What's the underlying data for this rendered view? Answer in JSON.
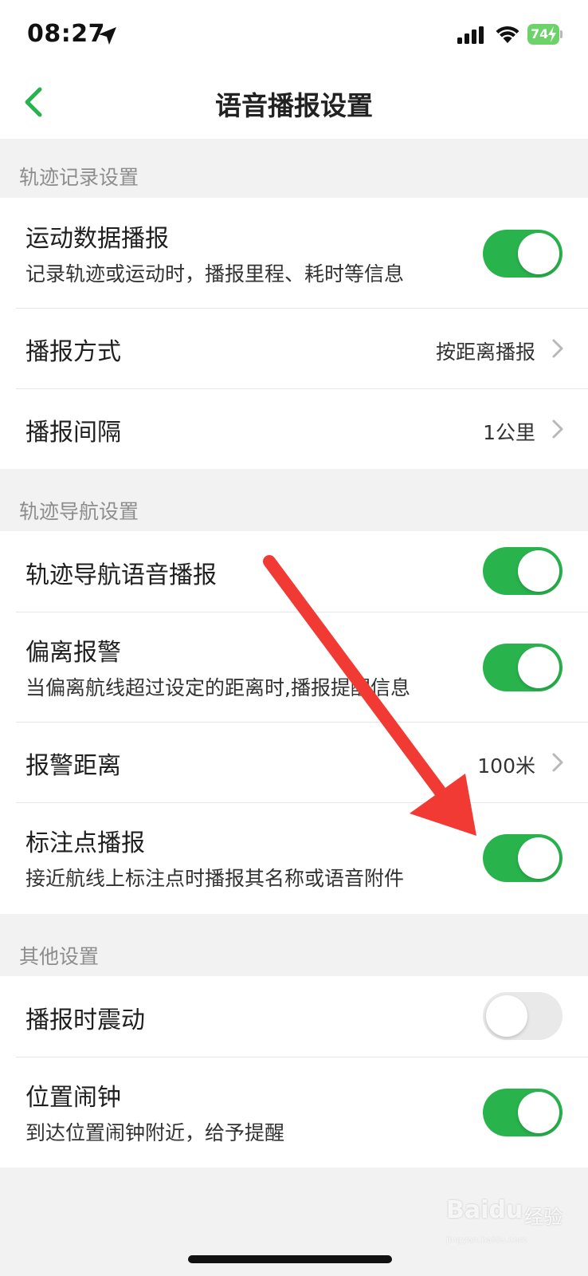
{
  "status_bar": {
    "time": "08:27",
    "battery": "74"
  },
  "nav": {
    "title": "语音播报设置"
  },
  "sections": [
    {
      "header": "轨迹记录设置",
      "rows": [
        {
          "title": "运动数据播报",
          "subtitle": "记录轨迹或运动时，播报里程、耗时等信息",
          "toggle": true
        },
        {
          "title": "播报方式",
          "value": "按距离播报"
        },
        {
          "title": "播报间隔",
          "value": "1公里"
        }
      ]
    },
    {
      "header": "轨迹导航设置",
      "rows": [
        {
          "title": "轨迹导航语音播报",
          "toggle": true
        },
        {
          "title": "偏离报警",
          "subtitle": "当偏离航线超过设定的距离时,播报提醒信息",
          "toggle": true
        },
        {
          "title": "报警距离",
          "value": "100米"
        },
        {
          "title": "标注点播报",
          "subtitle": "接近航线上标注点时播报其名称或语音附件",
          "toggle": true
        }
      ]
    },
    {
      "header": "其他设置",
      "rows": [
        {
          "title": "播报时震动",
          "toggle": false
        },
        {
          "title": "位置闹钟",
          "subtitle": "到达位置闹钟附近，给予提醒",
          "toggle": true
        }
      ]
    }
  ],
  "watermark": {
    "brand": "Baidu",
    "cn": "经验",
    "sub": "jingyan.baidu.com"
  },
  "colors": {
    "accent_green": "#29b34d",
    "back_green": "#29b34d",
    "arrow_red": "#f03a33",
    "toggle_off": "#e9e9ea"
  }
}
